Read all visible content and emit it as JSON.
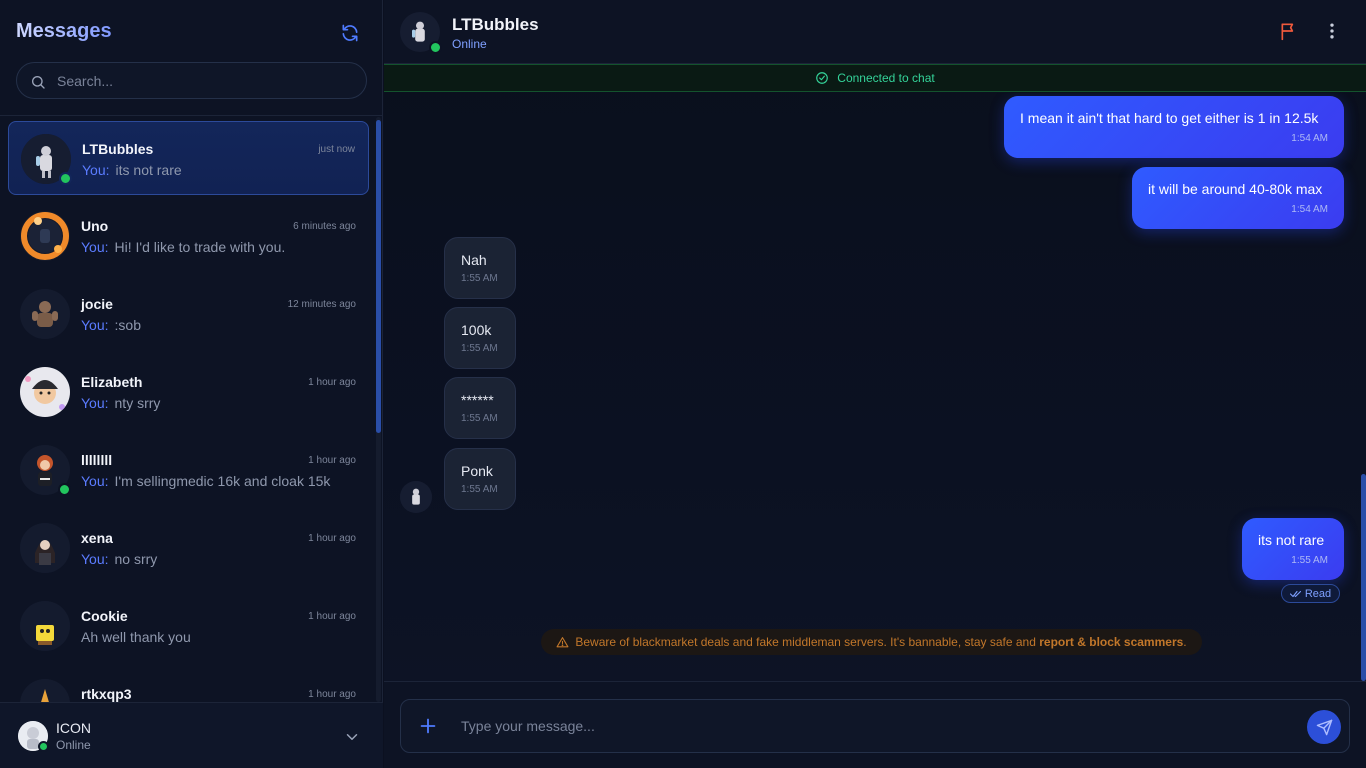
{
  "sidebar": {
    "title": "Messages",
    "search_placeholder": "Search...",
    "you_label": "You:",
    "conversations": [
      {
        "name": "LTBubbles",
        "time": "just now",
        "preview": "its not rare",
        "from_you": true,
        "online": true,
        "active": true
      },
      {
        "name": "Uno",
        "time": "6 minutes ago",
        "preview": "Hi! I'd like to trade with you.",
        "from_you": true,
        "online": false,
        "active": false
      },
      {
        "name": "jocie",
        "time": "12 minutes ago",
        "preview": ":sob",
        "from_you": true,
        "online": false,
        "active": false
      },
      {
        "name": "Elizabeth",
        "time": "1 hour ago",
        "preview": "nty srry",
        "from_you": true,
        "online": false,
        "active": false
      },
      {
        "name": "llllllll",
        "time": "1 hour ago",
        "preview": "I'm sellingmedic 16k and cloak 15k",
        "from_you": true,
        "online": true,
        "active": false
      },
      {
        "name": "xena",
        "time": "1 hour ago",
        "preview": "no srry",
        "from_you": true,
        "online": false,
        "active": false
      },
      {
        "name": "Cookie",
        "time": "1 hour ago",
        "preview": "Ah well thank you",
        "from_you": false,
        "online": false,
        "active": false
      },
      {
        "name": "rtkxqp3",
        "time": "1 hour ago",
        "preview": "",
        "from_you": false,
        "online": false,
        "active": false
      }
    ],
    "current_user": {
      "name": "ICON",
      "status": "Online"
    }
  },
  "chat": {
    "contact_name": "LTBubbles",
    "contact_status": "Online",
    "connection_status": "Connected to chat",
    "messages": [
      {
        "direction": "out",
        "text": "I mean it ain't that hard to get either is 1 in 12.5k",
        "time": "1:54 AM"
      },
      {
        "direction": "out",
        "text": "it will be around 40-80k max",
        "time": "1:54 AM"
      },
      {
        "direction": "in",
        "text": "Nah",
        "time": "1:55 AM"
      },
      {
        "direction": "in",
        "text": "100k",
        "time": "1:55 AM"
      },
      {
        "direction": "in",
        "text": "******",
        "time": "1:55 AM"
      },
      {
        "direction": "in",
        "text": "Ponk",
        "time": "1:55 AM"
      },
      {
        "direction": "out",
        "text": "its not rare",
        "time": "1:55 AM"
      }
    ],
    "read_label": "Read",
    "warning": {
      "text": "Beware of blackmarket deals and fake middleman servers. It's bannable, stay safe and ",
      "emphasis": "report & block scammers",
      "suffix": "."
    },
    "composer_placeholder": "Type your message..."
  },
  "colors": {
    "accent": "#2f5bff",
    "online": "#22c55e",
    "connected": "#34d399",
    "warning": "#c2772a",
    "flag": "#ef5a3c"
  },
  "icons": {
    "refresh": "refresh-icon",
    "search": "search-icon",
    "flag": "flag-icon",
    "more": "more-vertical-icon",
    "check_circle": "check-circle-icon",
    "double_check": "double-check-icon",
    "warning": "warning-triangle-icon",
    "plus": "plus-icon",
    "send": "send-icon",
    "chevron": "chevron-down-icon"
  }
}
